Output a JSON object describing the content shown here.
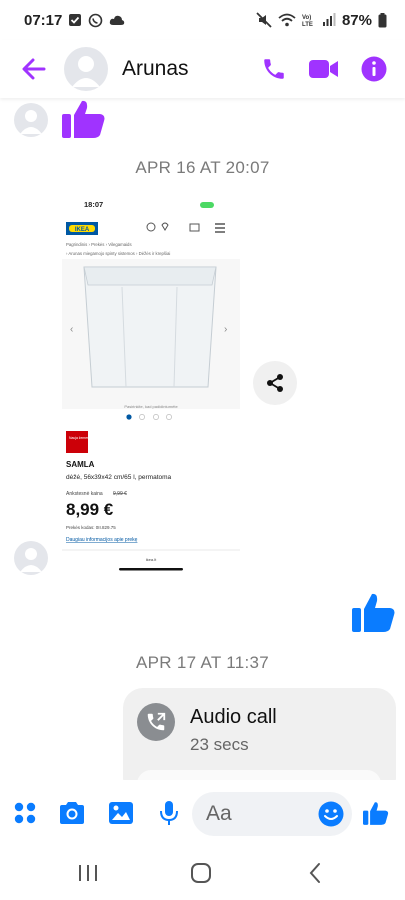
{
  "status_bar": {
    "time": "07:17",
    "battery": "87%"
  },
  "header": {
    "contact_name": "Arunas"
  },
  "messages": {
    "date_1": "APR 16 AT 20:07",
    "date_2": "APR 17 AT 11:37"
  },
  "shared_screenshot": {
    "time": "18:07",
    "logo": "IKEA",
    "breadcrumb_1": "Pagrindinis › Prekės › Vilegamaids",
    "breadcrumb_2": "› Arunas miegamojo spinty sistemos › Dėžės ir krepšiai",
    "image_caption": "Pasirinkite, kad padidintumėte",
    "product_badge": "Nauja žemesnė kaina",
    "product_name": "SAMLA",
    "product_desc": "dėžė, 56x39x42 cm/65 l, permatoma",
    "old_price_label": "Ankstesnė kaina",
    "old_price": "9,99 €",
    "price": "8,99 €",
    "item_code": "Prekės kodas: 0II.829.75",
    "more_info": "Daugiau informacijos apie prekę",
    "bottom_bar": "ikea.lt"
  },
  "call": {
    "title": "Audio call",
    "duration": "23 secs"
  },
  "composer": {
    "placeholder": "Aa"
  },
  "colors": {
    "accent_purple": "#a033ff",
    "like_blue": "#0a7cff",
    "icon_blue": "#0a7cff"
  }
}
